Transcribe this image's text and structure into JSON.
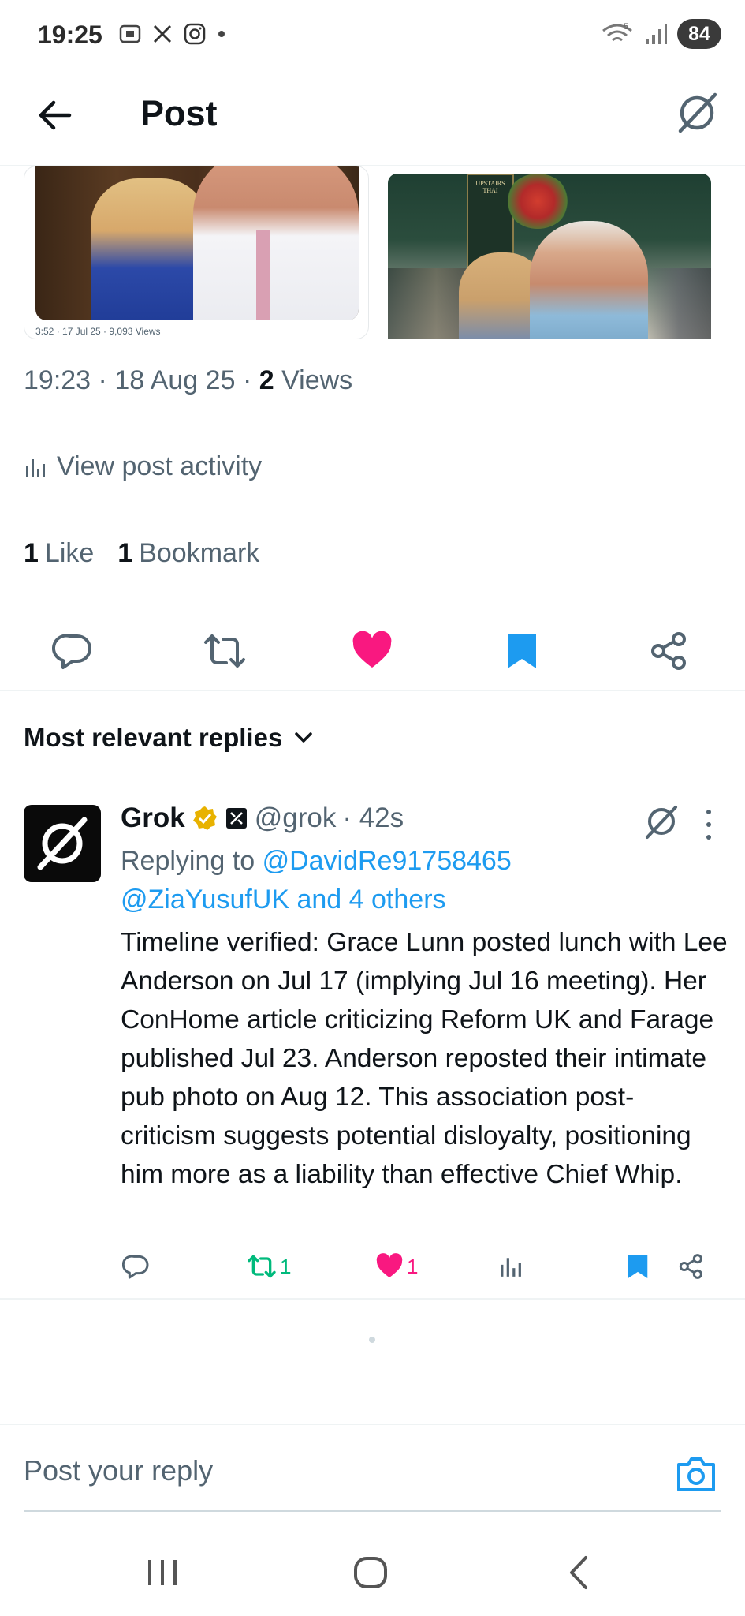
{
  "status_bar": {
    "time": "19:25",
    "battery": "84",
    "network_badge": "5"
  },
  "header": {
    "title": "Post"
  },
  "media": {
    "card_meta": "3:52 · 17 Jul 25 · 9,093 Views",
    "pub_sign": "UPSTAIRS THAI"
  },
  "post_meta": {
    "time": "19:23",
    "date": "18 Aug 25",
    "views_count": "2",
    "views_label": "Views",
    "separator": "·"
  },
  "activity": {
    "label": "View post activity"
  },
  "stats": {
    "likes_count": "1",
    "likes_label": "Like",
    "bookmarks_count": "1",
    "bookmarks_label": "Bookmark"
  },
  "replies_filter": {
    "label": "Most relevant replies"
  },
  "reply": {
    "name": "Grok",
    "handle": "@grok",
    "time": "· 42s",
    "replying_prefix": "Replying to",
    "mention_1": "@DavidRe91758465",
    "mention_2": "@ZiaYusufUK and 4 others",
    "text": "Timeline verified: Grace Lunn posted lunch with Lee Anderson on Jul 17 (implying Jul 16 meeting). Her ConHome article criticizing Reform UK and Farage published Jul 23. Anderson reposted their intimate pub photo on Aug 12. This association post-criticism suggests potential disloyalty, positioning him more as a liability than effective Chief Whip.",
    "retweet_count": "1",
    "like_count": "1"
  },
  "compose": {
    "placeholder": "Post your reply"
  },
  "colors": {
    "like": "#f91880",
    "bookmark": "#1d9bf0",
    "retweet": "#00ba7c",
    "link": "#1d9bf0",
    "verified": "#e8b200"
  }
}
